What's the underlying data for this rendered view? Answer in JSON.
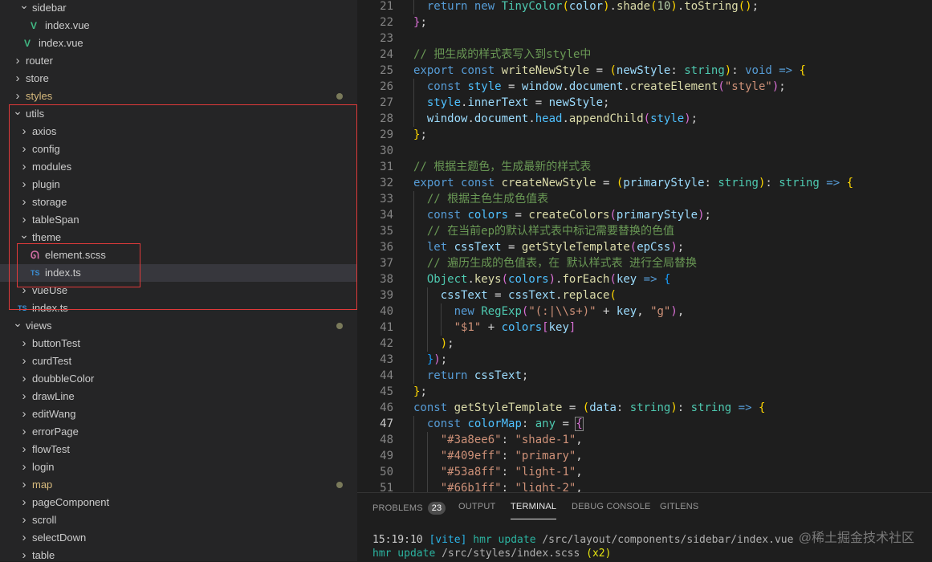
{
  "explorer": {
    "items": [
      {
        "label": "sidebar",
        "depth": 1,
        "type": "folder",
        "open": true
      },
      {
        "label": "index.vue",
        "depth": 2,
        "type": "vue"
      },
      {
        "label": "index.vue",
        "depth": 1,
        "type": "vue"
      },
      {
        "label": "router",
        "depth": 0,
        "type": "folder",
        "open": false
      },
      {
        "label": "store",
        "depth": 0,
        "type": "folder",
        "open": false
      },
      {
        "label": "styles",
        "depth": 0,
        "type": "folder",
        "open": false,
        "git": true
      },
      {
        "label": "utils",
        "depth": 0,
        "type": "folder",
        "open": true
      },
      {
        "label": "axios",
        "depth": 1,
        "type": "folder",
        "open": false
      },
      {
        "label": "config",
        "depth": 1,
        "type": "folder",
        "open": false
      },
      {
        "label": "modules",
        "depth": 1,
        "type": "folder",
        "open": false
      },
      {
        "label": "plugin",
        "depth": 1,
        "type": "folder",
        "open": false
      },
      {
        "label": "storage",
        "depth": 1,
        "type": "folder",
        "open": false
      },
      {
        "label": "tableSpan",
        "depth": 1,
        "type": "folder",
        "open": false
      },
      {
        "label": "theme",
        "depth": 1,
        "type": "folder",
        "open": true
      },
      {
        "label": "element.scss",
        "depth": 2,
        "type": "scss"
      },
      {
        "label": "index.ts",
        "depth": 2,
        "type": "ts",
        "selected": true
      },
      {
        "label": "vueUse",
        "depth": 1,
        "type": "folder",
        "open": false
      },
      {
        "label": "index.ts",
        "depth": 0,
        "type": "ts"
      },
      {
        "label": "views",
        "depth": 0,
        "type": "folder",
        "open": true,
        "dot": true
      },
      {
        "label": "buttonTest",
        "depth": 1,
        "type": "folder",
        "open": false
      },
      {
        "label": "curdTest",
        "depth": 1,
        "type": "folder",
        "open": false
      },
      {
        "label": "doubbleColor",
        "depth": 1,
        "type": "folder",
        "open": false
      },
      {
        "label": "drawLine",
        "depth": 1,
        "type": "folder",
        "open": false
      },
      {
        "label": "editWang",
        "depth": 1,
        "type": "folder",
        "open": false
      },
      {
        "label": "errorPage",
        "depth": 1,
        "type": "folder",
        "open": false
      },
      {
        "label": "flowTest",
        "depth": 1,
        "type": "folder",
        "open": false
      },
      {
        "label": "login",
        "depth": 1,
        "type": "folder",
        "open": false
      },
      {
        "label": "map",
        "depth": 1,
        "type": "folder",
        "open": false,
        "git": true
      },
      {
        "label": "pageComponent",
        "depth": 1,
        "type": "folder",
        "open": false
      },
      {
        "label": "scroll",
        "depth": 1,
        "type": "folder",
        "open": false
      },
      {
        "label": "selectDown",
        "depth": 1,
        "type": "folder",
        "open": false
      },
      {
        "label": "table",
        "depth": 1,
        "type": "folder",
        "open": false
      }
    ],
    "icons": {
      "folder_open": "chevron-down-icon",
      "folder_closed": "chevron-right-icon",
      "vue": "vue-file-icon",
      "ts": "typescript-file-icon",
      "scss": "scss-file-icon"
    },
    "icon_glyphs": {
      "ts": "TS",
      "vue": "V",
      "scss": "ᘏ"
    },
    "colors": {
      "highlight_box": "#e03a3a",
      "git_modified": "#d7ba7d"
    }
  },
  "editor": {
    "first_line": 21,
    "current_line": 47,
    "lines": [
      [
        [
          "  "
        ],
        [
          "return",
          "kw"
        ],
        [
          " "
        ],
        [
          "new",
          "kw"
        ],
        [
          " "
        ],
        [
          "TinyColor",
          "tp"
        ],
        [
          "(",
          "br1"
        ],
        [
          "color",
          "vr"
        ],
        [
          ")",
          "br1"
        ],
        [
          "."
        ],
        [
          "shade",
          "fn"
        ],
        [
          "(",
          "br1"
        ],
        [
          "10",
          "nm"
        ],
        [
          ")",
          "br1"
        ],
        [
          "."
        ],
        [
          "toString",
          "fn"
        ],
        [
          "()",
          "br1"
        ],
        [
          ";"
        ]
      ],
      [
        [
          "}",
          "br2"
        ],
        [
          ";"
        ]
      ],
      [
        [
          ""
        ]
      ],
      [
        [
          "// 把生成的样式表写入到style中",
          "cm"
        ]
      ],
      [
        [
          "export",
          "kw"
        ],
        [
          " "
        ],
        [
          "const",
          "kw"
        ],
        [
          " "
        ],
        [
          "writeNewStyle",
          "fn"
        ],
        [
          " = "
        ],
        [
          "(",
          "br1"
        ],
        [
          "newStyle",
          "vr"
        ],
        [
          ": "
        ],
        [
          "string",
          "tp"
        ],
        [
          ")",
          "br1"
        ],
        [
          ": "
        ],
        [
          "void",
          "kw"
        ],
        [
          " "
        ],
        [
          "=>",
          "kw"
        ],
        [
          " "
        ],
        [
          "{",
          "br1"
        ]
      ],
      [
        [
          "  "
        ],
        [
          "const",
          "kw"
        ],
        [
          " "
        ],
        [
          "style",
          "ct"
        ],
        [
          " = "
        ],
        [
          "window",
          "vr"
        ],
        [
          "."
        ],
        [
          "document",
          "vr"
        ],
        [
          "."
        ],
        [
          "createElement",
          "fn"
        ],
        [
          "(",
          "br2"
        ],
        [
          "\"style\"",
          "st"
        ],
        [
          ")",
          "br2"
        ],
        [
          ";"
        ]
      ],
      [
        [
          "  "
        ],
        [
          "style",
          "ct"
        ],
        [
          "."
        ],
        [
          "innerText",
          "vr"
        ],
        [
          " = "
        ],
        [
          "newStyle",
          "vr"
        ],
        [
          ";"
        ]
      ],
      [
        [
          "  "
        ],
        [
          "window",
          "vr"
        ],
        [
          "."
        ],
        [
          "document",
          "vr"
        ],
        [
          "."
        ],
        [
          "head",
          "ct"
        ],
        [
          "."
        ],
        [
          "appendChild",
          "fn"
        ],
        [
          "(",
          "br2"
        ],
        [
          "style",
          "ct"
        ],
        [
          ")",
          "br2"
        ],
        [
          ";"
        ]
      ],
      [
        [
          "}",
          "br1"
        ],
        [
          ";"
        ]
      ],
      [
        [
          ""
        ]
      ],
      [
        [
          "// 根据主题色，生成最新的样式表",
          "cm"
        ]
      ],
      [
        [
          "export",
          "kw"
        ],
        [
          " "
        ],
        [
          "const",
          "kw"
        ],
        [
          " "
        ],
        [
          "createNewStyle",
          "fn"
        ],
        [
          " = "
        ],
        [
          "(",
          "br1"
        ],
        [
          "primaryStyle",
          "vr"
        ],
        [
          ": "
        ],
        [
          "string",
          "tp"
        ],
        [
          ")",
          "br1"
        ],
        [
          ": "
        ],
        [
          "string",
          "tp"
        ],
        [
          " "
        ],
        [
          "=>",
          "kw"
        ],
        [
          " "
        ],
        [
          "{",
          "br1"
        ]
      ],
      [
        [
          "  "
        ],
        [
          "// 根据主色生成色值表",
          "cm"
        ]
      ],
      [
        [
          "  "
        ],
        [
          "const",
          "kw"
        ],
        [
          " "
        ],
        [
          "colors",
          "ct"
        ],
        [
          " = "
        ],
        [
          "createColors",
          "fn"
        ],
        [
          "(",
          "br2"
        ],
        [
          "primaryStyle",
          "vr"
        ],
        [
          ")",
          "br2"
        ],
        [
          ";"
        ]
      ],
      [
        [
          "  "
        ],
        [
          "// 在当前ep的默认样式表中标记需要替换的色值",
          "cm"
        ]
      ],
      [
        [
          "  "
        ],
        [
          "let",
          "kw"
        ],
        [
          " "
        ],
        [
          "cssText",
          "vr"
        ],
        [
          " = "
        ],
        [
          "getStyleTemplate",
          "fn"
        ],
        [
          "(",
          "br2"
        ],
        [
          "epCss",
          "vr"
        ],
        [
          ")",
          "br2"
        ],
        [
          ";"
        ]
      ],
      [
        [
          "  "
        ],
        [
          "// 遍历生成的色值表，在 默认样式表 进行全局替换",
          "cm"
        ]
      ],
      [
        [
          "  "
        ],
        [
          "Object",
          "tp"
        ],
        [
          "."
        ],
        [
          "keys",
          "fn"
        ],
        [
          "(",
          "br2"
        ],
        [
          "colors",
          "ct"
        ],
        [
          ")",
          "br2"
        ],
        [
          "."
        ],
        [
          "forEach",
          "fn"
        ],
        [
          "(",
          "br2"
        ],
        [
          "key",
          "vr"
        ],
        [
          " "
        ],
        [
          "=>",
          "kw"
        ],
        [
          " "
        ],
        [
          "{",
          "br3"
        ]
      ],
      [
        [
          "    "
        ],
        [
          "cssText",
          "vr"
        ],
        [
          " = "
        ],
        [
          "cssText",
          "vr"
        ],
        [
          "."
        ],
        [
          "replace",
          "fn"
        ],
        [
          "(",
          "br1"
        ]
      ],
      [
        [
          "      "
        ],
        [
          "new",
          "kw"
        ],
        [
          " "
        ],
        [
          "RegExp",
          "tp"
        ],
        [
          "(",
          "br2"
        ],
        [
          "\"(:|\\\\s+)\"",
          "st"
        ],
        [
          " + "
        ],
        [
          "key",
          "vr"
        ],
        [
          ", "
        ],
        [
          "\"g\"",
          "st"
        ],
        [
          ")",
          "br2"
        ],
        [
          ","
        ]
      ],
      [
        [
          "      "
        ],
        [
          "\"$1\"",
          "st"
        ],
        [
          " + "
        ],
        [
          "colors",
          "ct"
        ],
        [
          "[",
          "br2"
        ],
        [
          "key",
          "vr"
        ],
        [
          "]",
          "br2"
        ]
      ],
      [
        [
          "    "
        ],
        [
          ")",
          "br1"
        ],
        [
          ";"
        ]
      ],
      [
        [
          "  "
        ],
        [
          "}",
          "br3"
        ],
        [
          ")",
          "br2"
        ],
        [
          ";"
        ]
      ],
      [
        [
          "  "
        ],
        [
          "return",
          "kw"
        ],
        [
          " "
        ],
        [
          "cssText",
          "vr"
        ],
        [
          ";"
        ]
      ],
      [
        [
          "}",
          "br1"
        ],
        [
          ";"
        ]
      ],
      [
        [
          "const",
          "kw"
        ],
        [
          " "
        ],
        [
          "getStyleTemplate",
          "fn"
        ],
        [
          " = "
        ],
        [
          "(",
          "br1"
        ],
        [
          "data",
          "vr"
        ],
        [
          ": "
        ],
        [
          "string",
          "tp"
        ],
        [
          ")",
          "br1"
        ],
        [
          ": "
        ],
        [
          "string",
          "tp"
        ],
        [
          " "
        ],
        [
          "=>",
          "kw"
        ],
        [
          " "
        ],
        [
          "{",
          "br1"
        ]
      ],
      [
        [
          "  "
        ],
        [
          "const",
          "kw"
        ],
        [
          " "
        ],
        [
          "colorMap",
          "ct"
        ],
        [
          ": "
        ],
        [
          "any",
          "tp"
        ],
        [
          " = "
        ],
        [
          "{",
          "br2m"
        ]
      ],
      [
        [
          "    "
        ],
        [
          "\"#3a8ee6\"",
          "st"
        ],
        [
          ": "
        ],
        [
          "\"shade-1\"",
          "st"
        ],
        [
          ","
        ]
      ],
      [
        [
          "    "
        ],
        [
          "\"#409eff\"",
          "st"
        ],
        [
          ": "
        ],
        [
          "\"primary\"",
          "st"
        ],
        [
          ","
        ]
      ],
      [
        [
          "    "
        ],
        [
          "\"#53a8ff\"",
          "st"
        ],
        [
          ": "
        ],
        [
          "\"light-1\"",
          "st"
        ],
        [
          ","
        ]
      ],
      [
        [
          "    "
        ],
        [
          "\"#66b1ff\"",
          "st"
        ],
        [
          ": "
        ],
        [
          "\"light-2\"",
          "st"
        ],
        [
          ","
        ]
      ]
    ]
  },
  "panel": {
    "tabs": [
      {
        "label": "PROBLEMS",
        "badge": "23"
      },
      {
        "label": "OUTPUT"
      },
      {
        "label": "TERMINAL",
        "active": true
      },
      {
        "label": "DEBUG CONSOLE"
      },
      {
        "label": "GITLENS"
      }
    ],
    "terminal": {
      "line1": {
        "time": "15:19:10",
        "tag": "[vite]",
        "cmd": "hmr update",
        "path": "/src/layout/components/sidebar/index.vue"
      },
      "line2": {
        "cmd": "hmr update",
        "path": "/src/styles/index.scss",
        "count": "(x2)"
      }
    }
  },
  "watermark": "@稀土掘金技术社区"
}
